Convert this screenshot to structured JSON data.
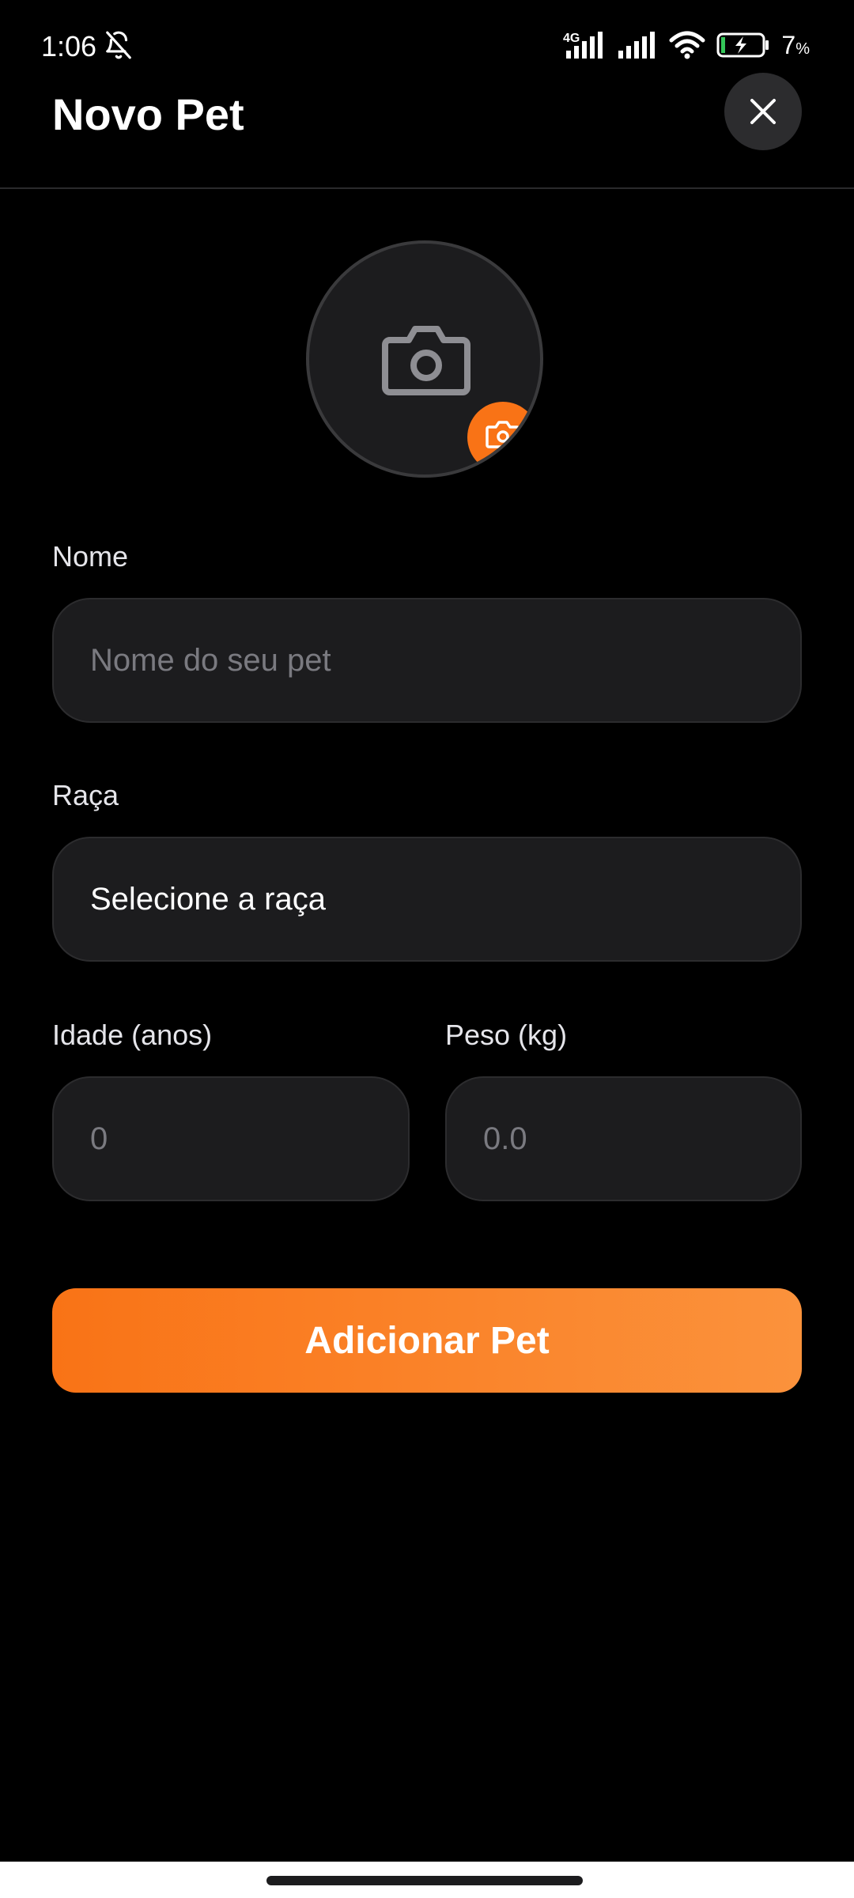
{
  "status_bar": {
    "time": "1:06",
    "network": "4G",
    "battery_value": "7",
    "battery_unit": "%"
  },
  "header": {
    "title": "Novo Pet"
  },
  "form": {
    "name": {
      "label": "Nome",
      "placeholder": "Nome do seu pet"
    },
    "breed": {
      "label": "Raça",
      "value": "Selecione a raça"
    },
    "age": {
      "label": "Idade (anos)",
      "placeholder": "0"
    },
    "weight": {
      "label": "Peso (kg)",
      "placeholder": "0.0"
    },
    "submit_label": "Adicionar Pet"
  },
  "colors": {
    "accent": "#f97316",
    "background": "#000000",
    "field_bg": "#1c1c1e"
  },
  "icons": [
    "bell-off-icon",
    "signal-icon",
    "wifi-icon",
    "battery-charging-icon",
    "close-icon",
    "camera-icon"
  ]
}
